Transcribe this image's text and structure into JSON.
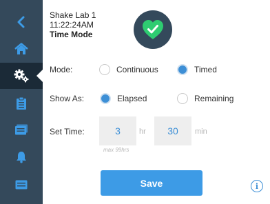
{
  "colors": {
    "sidebar": "#34495b",
    "sidebar_active": "#1b2a37",
    "accent": "#3d9be6",
    "value_text": "#3d8fd6",
    "status_ok": "#2ecc71"
  },
  "sidebar": {
    "items": [
      {
        "icon": "chevron-left-icon"
      },
      {
        "icon": "home-icon"
      },
      {
        "icon": "settings-gears-icon",
        "active": true
      },
      {
        "icon": "clipboard-icon"
      },
      {
        "icon": "programs-icon"
      },
      {
        "icon": "bell-icon"
      },
      {
        "icon": "card-icon"
      }
    ]
  },
  "header": {
    "device_name": "Shake Lab 1",
    "time": "11:22:24AM",
    "mode": "Time Mode",
    "status_icon": "heart-check-icon"
  },
  "mode": {
    "label": "Mode:",
    "options": [
      {
        "label": "Continuous",
        "selected": false
      },
      {
        "label": "Timed",
        "selected": true
      }
    ]
  },
  "show_as": {
    "label": "Show As:",
    "options": [
      {
        "label": "Elapsed",
        "selected": true
      },
      {
        "label": "Remaining",
        "selected": false
      }
    ]
  },
  "set_time": {
    "label": "Set Time:",
    "hours": "3",
    "hours_unit": "hr",
    "minutes": "30",
    "minutes_unit": "min",
    "hint": "max 99hrs"
  },
  "save_label": "Save",
  "info_glyph": "i"
}
